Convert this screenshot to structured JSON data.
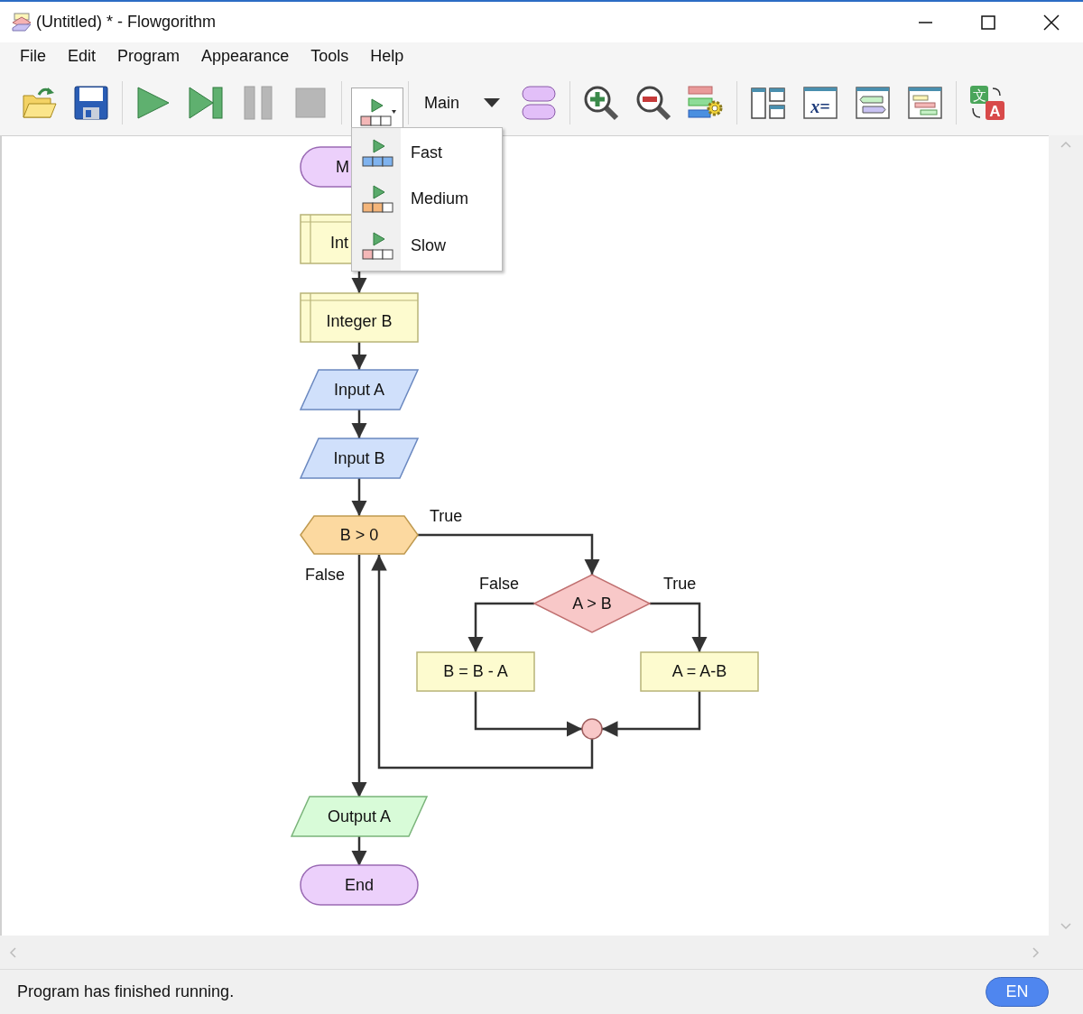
{
  "window": {
    "title": "(Untitled) * - Flowgorithm"
  },
  "menu_bar": [
    "File",
    "Edit",
    "Program",
    "Appearance",
    "Tools",
    "Help"
  ],
  "toolbar": [
    {
      "kind": "open"
    },
    {
      "kind": "save"
    },
    {
      "kind": "separator"
    },
    {
      "kind": "run",
      "disabled": false
    },
    {
      "kind": "step",
      "disabled": false
    },
    {
      "kind": "pause",
      "disabled": true
    },
    {
      "kind": "stop",
      "disabled": true
    },
    {
      "kind": "separator"
    },
    {
      "kind": "speed",
      "expanded": true
    },
    {
      "kind": "separator"
    },
    {
      "kind": "function_select",
      "value": "Main"
    },
    {
      "kind": "functions"
    },
    {
      "kind": "separator"
    },
    {
      "kind": "zoom_in"
    },
    {
      "kind": "zoom_out"
    },
    {
      "kind": "layout_settings"
    },
    {
      "kind": "separator"
    },
    {
      "kind": "panels"
    },
    {
      "kind": "variables",
      "glyph": "x="
    },
    {
      "kind": "console"
    },
    {
      "kind": "chart"
    },
    {
      "kind": "separator"
    },
    {
      "kind": "translate",
      "glyph": "文",
      "glyph_2": "A"
    }
  ],
  "speed_menu": {
    "items": [
      {
        "kind": "fast",
        "label": "Fast"
      },
      {
        "kind": "medium",
        "label": "Medium"
      },
      {
        "kind": "slow",
        "label": "Slow"
      }
    ]
  },
  "flowchart": {
    "nodes": [
      {
        "kind": "terminal",
        "text": "M"
      },
      {
        "kind": "declare",
        "text": "Int"
      },
      {
        "kind": "declare",
        "text": "Integer B"
      },
      {
        "kind": "input",
        "text": "Input A"
      },
      {
        "kind": "input",
        "text": "Input B"
      },
      {
        "kind": "while",
        "text": "B > 0"
      },
      {
        "kind": "if",
        "text": "A > B"
      },
      {
        "kind": "assign",
        "text": "B = B - A"
      },
      {
        "kind": "assign",
        "text": "A = A-B"
      },
      {
        "kind": "junction"
      },
      {
        "kind": "output",
        "text": "Output A"
      },
      {
        "kind": "terminal",
        "text": "End"
      }
    ],
    "branch_labels": [
      "True",
      "False",
      "False",
      "True"
    ]
  },
  "status_bar": {
    "message": "Program has finished running.",
    "language": "EN"
  }
}
